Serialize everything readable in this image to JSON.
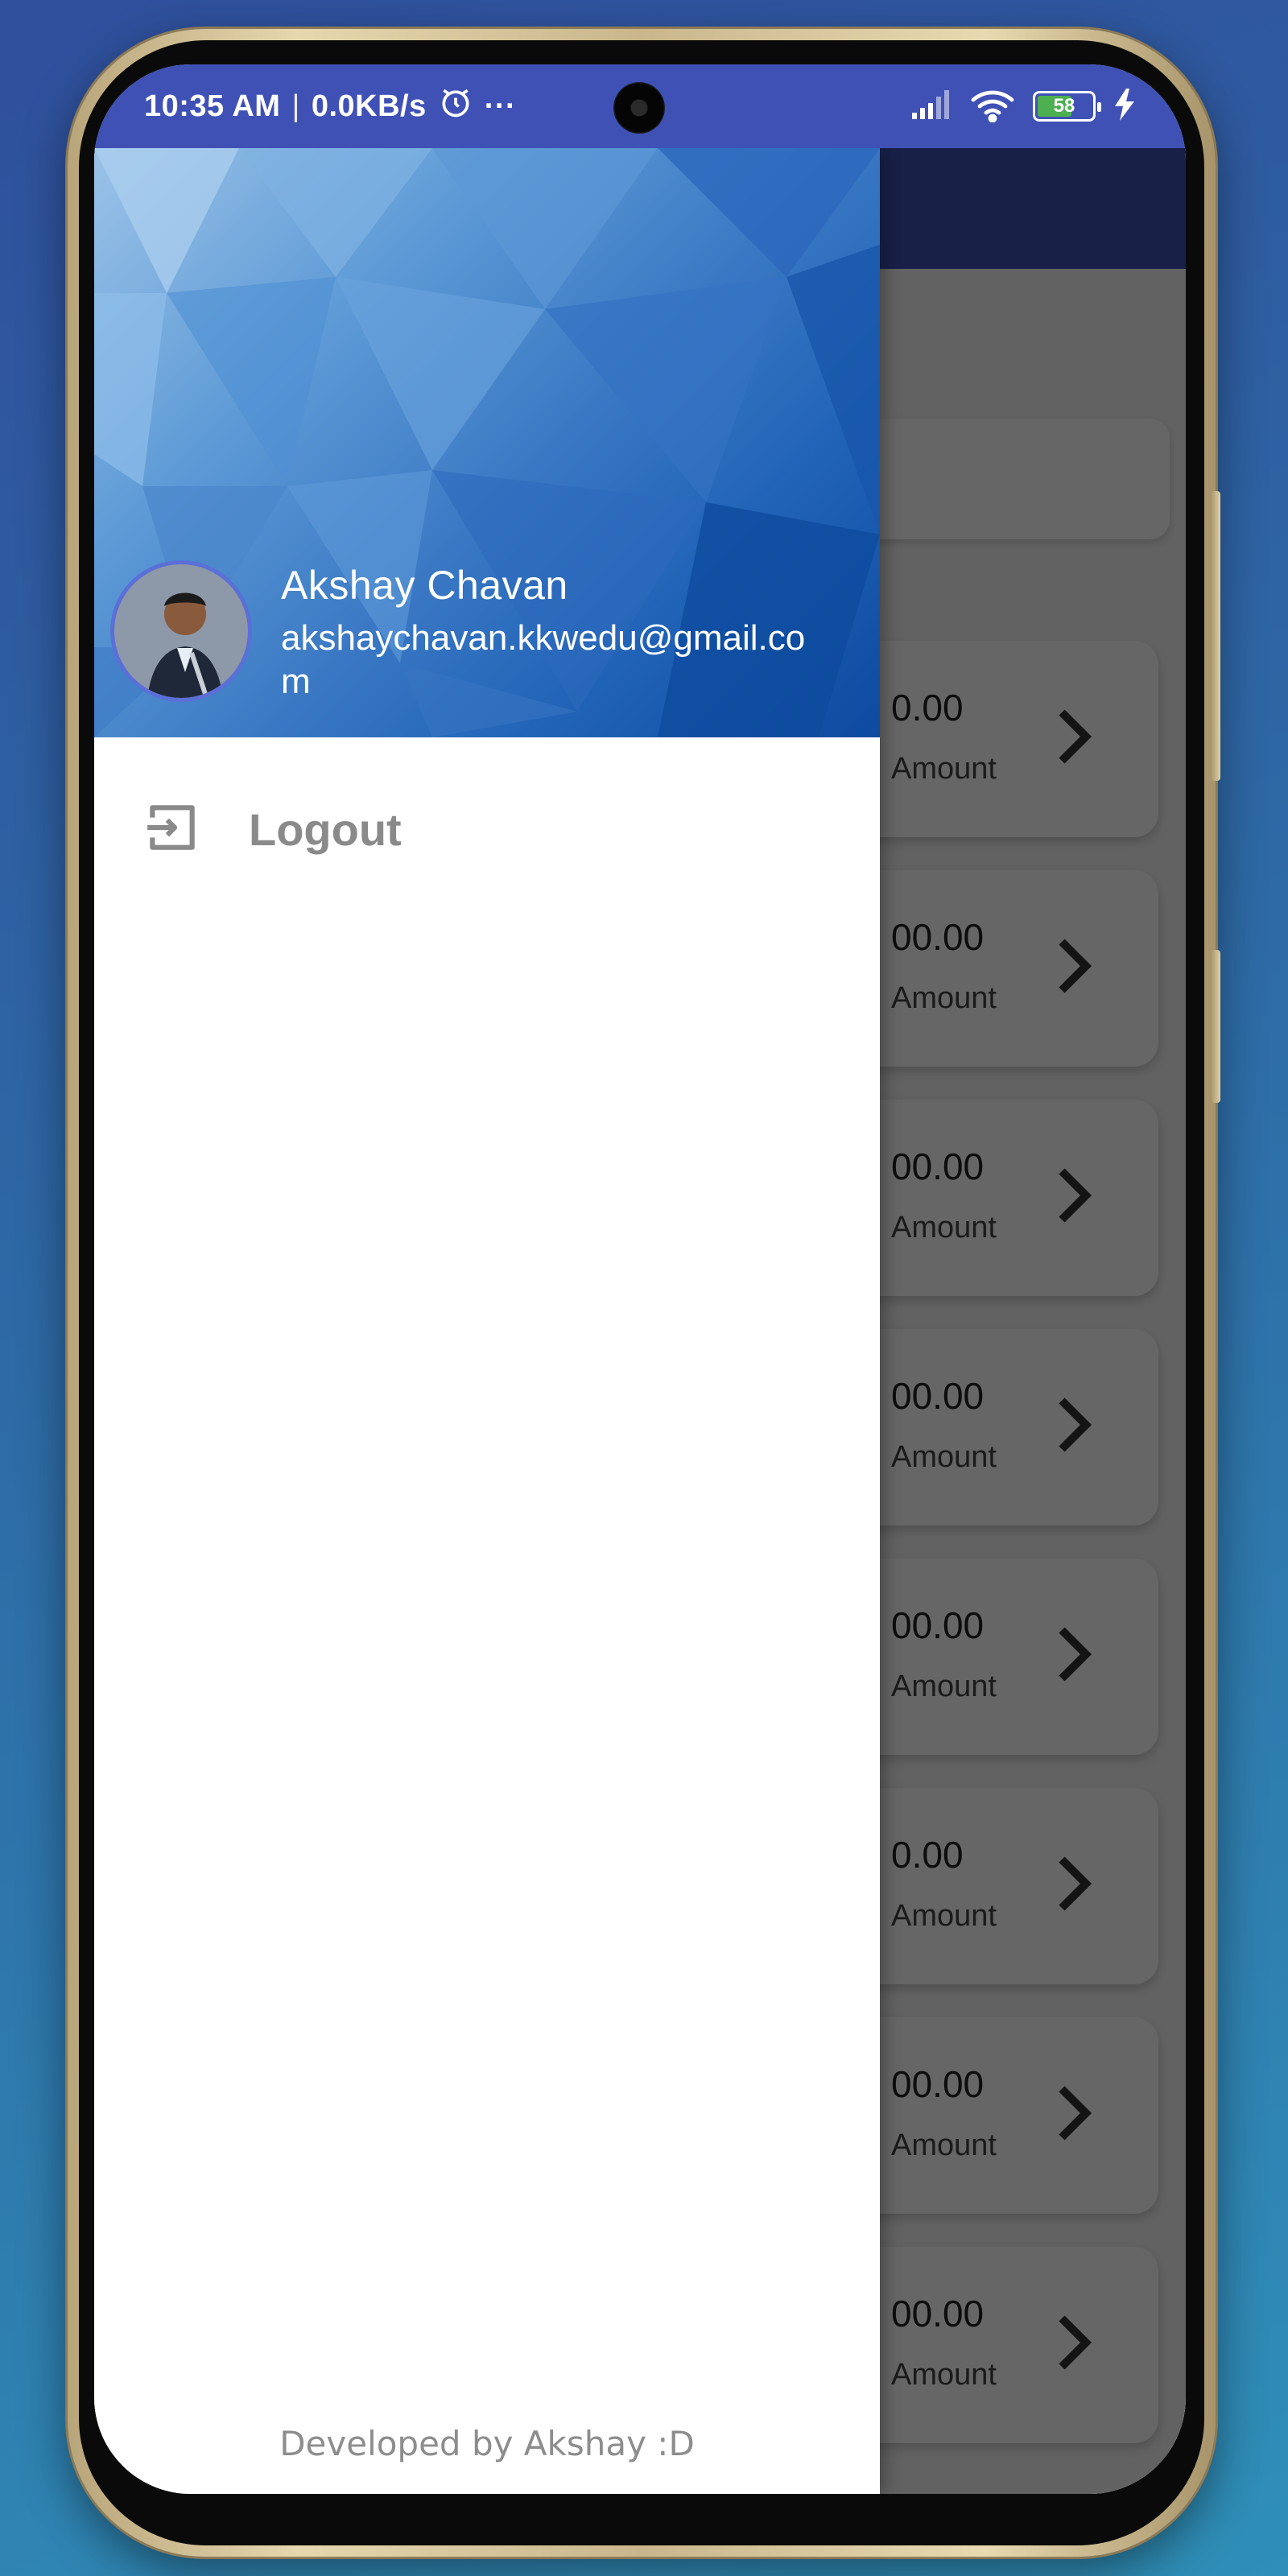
{
  "status_bar": {
    "time": "10:35 AM",
    "separator": "|",
    "speed": "0.0KB/s",
    "more": "···",
    "battery": "58",
    "icons": [
      "alarm-icon",
      "signal-icon",
      "wifi-icon",
      "battery-icon",
      "charging-icon"
    ]
  },
  "drawer": {
    "user_name": "Akshay Chavan",
    "user_email": "akshaychavan.kkwedu@gmail.com",
    "menu": [
      {
        "label": "Logout",
        "icon": "logout-icon"
      }
    ],
    "footer": "Developed by Akshay :D"
  },
  "background_cards": [
    {
      "amount": "0.00",
      "label": "Amount"
    },
    {
      "amount": "00.00",
      "label": "Amount"
    },
    {
      "amount": "00.00",
      "label": "Amount"
    },
    {
      "amount": "00.00",
      "label": "Amount"
    },
    {
      "amount": "00.00",
      "label": "Amount"
    },
    {
      "amount": "0.00",
      "label": "Amount"
    },
    {
      "amount": "00.00",
      "label": "Amount"
    },
    {
      "amount": "00.00",
      "label": "Amount"
    }
  ],
  "colors": {
    "primary": "#3f51b5",
    "scrim": "#000000",
    "battery_fill": "#4caf50"
  }
}
